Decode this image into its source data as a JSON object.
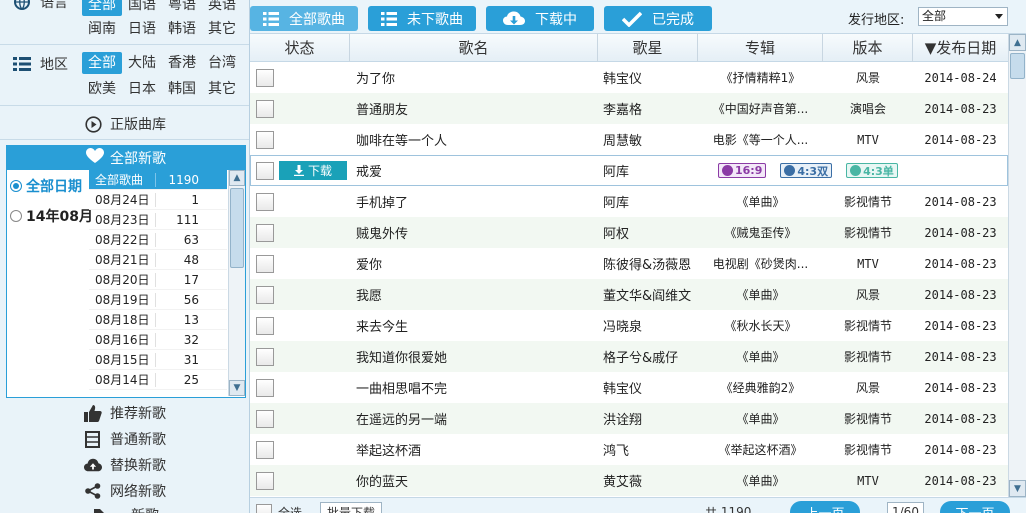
{
  "sidebar": {
    "language": {
      "label": "语言",
      "row1": [
        {
          "label": "全部",
          "selected": true
        },
        {
          "label": "国语"
        },
        {
          "label": "粤语"
        },
        {
          "label": "英语"
        }
      ],
      "row2": [
        {
          "label": "闽南"
        },
        {
          "label": "日语"
        },
        {
          "label": "韩语"
        },
        {
          "label": "其它"
        }
      ]
    },
    "region": {
      "label": "地区",
      "row1": [
        {
          "label": "全部",
          "selected": true
        },
        {
          "label": "大陆"
        },
        {
          "label": "香港"
        },
        {
          "label": "台湾"
        }
      ],
      "row2": [
        {
          "label": "欧美"
        },
        {
          "label": "日本"
        },
        {
          "label": "韩国"
        },
        {
          "label": "其它"
        }
      ]
    },
    "official_library": "正版曲库",
    "new_songs_header": "全部新歌",
    "date_radios": [
      {
        "label": "全部日期",
        "selected": true
      },
      {
        "label": "14年08月"
      }
    ],
    "date_list": [
      {
        "date": "全部歌曲",
        "count": "1190",
        "selected": true
      },
      {
        "date": "08月24日",
        "count": "1"
      },
      {
        "date": "08月23日",
        "count": "111"
      },
      {
        "date": "08月22日",
        "count": "63"
      },
      {
        "date": "08月21日",
        "count": "48"
      },
      {
        "date": "08月20日",
        "count": "17"
      },
      {
        "date": "08月19日",
        "count": "56"
      },
      {
        "date": "08月18日",
        "count": "13"
      },
      {
        "date": "08月16日",
        "count": "32"
      },
      {
        "date": "08月15日",
        "count": "31"
      },
      {
        "date": "08月14日",
        "count": "25"
      }
    ],
    "links": [
      {
        "label": "推荐新歌",
        "icon": "thumbs-up-icon"
      },
      {
        "label": "普通新歌",
        "icon": "calendar-icon"
      },
      {
        "label": "替换新歌",
        "icon": "cloud-upload-icon"
      },
      {
        "label": "网络新歌",
        "icon": "share-icon"
      }
    ],
    "partial_bottom_link": "…新歌"
  },
  "toolbar": {
    "tabs": [
      {
        "label": "全部歌曲",
        "icon": "list-icon",
        "selected": true
      },
      {
        "label": "未下歌曲",
        "icon": "list-icon"
      },
      {
        "label": "下载中",
        "icon": "cloud-download-icon"
      },
      {
        "label": "已完成",
        "icon": "check-icon"
      }
    ],
    "region_label": "发行地区:",
    "region_value": "全部"
  },
  "table": {
    "headers": {
      "status": "状态",
      "title": "歌名",
      "artist": "歌星",
      "album": "专辑",
      "version": "版本",
      "date": "▼发布日期"
    },
    "download_label": "下载",
    "formats": [
      "16:9",
      "4:3双",
      "4:3单"
    ],
    "rows": [
      {
        "title": "为了你",
        "artist": "韩宝仪",
        "album": "《抒情精粹1》",
        "version": "风景",
        "date": "2014-08-24"
      },
      {
        "title": "普通朋友",
        "artist": "李嘉格",
        "album": "《中国好声音第...",
        "version": "演唱会",
        "date": "2014-08-23"
      },
      {
        "title": "咖啡在等一个人",
        "artist": "周慧敏",
        "album": "电影《等一个人...",
        "version": "MTV",
        "date": "2014-08-23"
      },
      {
        "title": "戒爱",
        "artist": "阿库",
        "album": "",
        "version": "",
        "date": "",
        "hover": true
      },
      {
        "title": "手机掉了",
        "artist": "阿库",
        "album": "《单曲》",
        "version": "影视情节",
        "date": "2014-08-23"
      },
      {
        "title": "贼鬼外传",
        "artist": "阿权",
        "album": "《贼鬼歪传》",
        "version": "影视情节",
        "date": "2014-08-23"
      },
      {
        "title": "爱你",
        "artist": "陈彼得&汤薇恩",
        "album": "电视剧《砂煲肉...",
        "version": "MTV",
        "date": "2014-08-23"
      },
      {
        "title": "我愿",
        "artist": "董文华&阎维文",
        "album": "《单曲》",
        "version": "风景",
        "date": "2014-08-23"
      },
      {
        "title": "来去今生",
        "artist": "冯晓泉",
        "album": "《秋水长天》",
        "version": "影视情节",
        "date": "2014-08-23"
      },
      {
        "title": "我知道你很爱她",
        "artist": "格子兮&戚仔",
        "album": "《单曲》",
        "version": "影视情节",
        "date": "2014-08-23"
      },
      {
        "title": "一曲相思唱不完",
        "artist": "韩宝仪",
        "album": "《经典雅韵2》",
        "version": "风景",
        "date": "2014-08-23"
      },
      {
        "title": "在遥远的另一端",
        "artist": "洪诠翔",
        "album": "《单曲》",
        "version": "影视情节",
        "date": "2014-08-23"
      },
      {
        "title": "举起这杯酒",
        "artist": "鸿飞",
        "album": "《举起这杯酒》",
        "version": "影视情节",
        "date": "2014-08-23"
      },
      {
        "title": "你的蓝天",
        "artist": "黄艾薇",
        "album": "《单曲》",
        "version": "MTV",
        "date": "2014-08-23"
      }
    ]
  },
  "footer": {
    "select_all": "全选",
    "batch_download": "批量下载",
    "total_prefix": "共",
    "total_count": "1190",
    "prev_page": "上一页",
    "page_value": "1/60",
    "next_page": "下一页"
  }
}
